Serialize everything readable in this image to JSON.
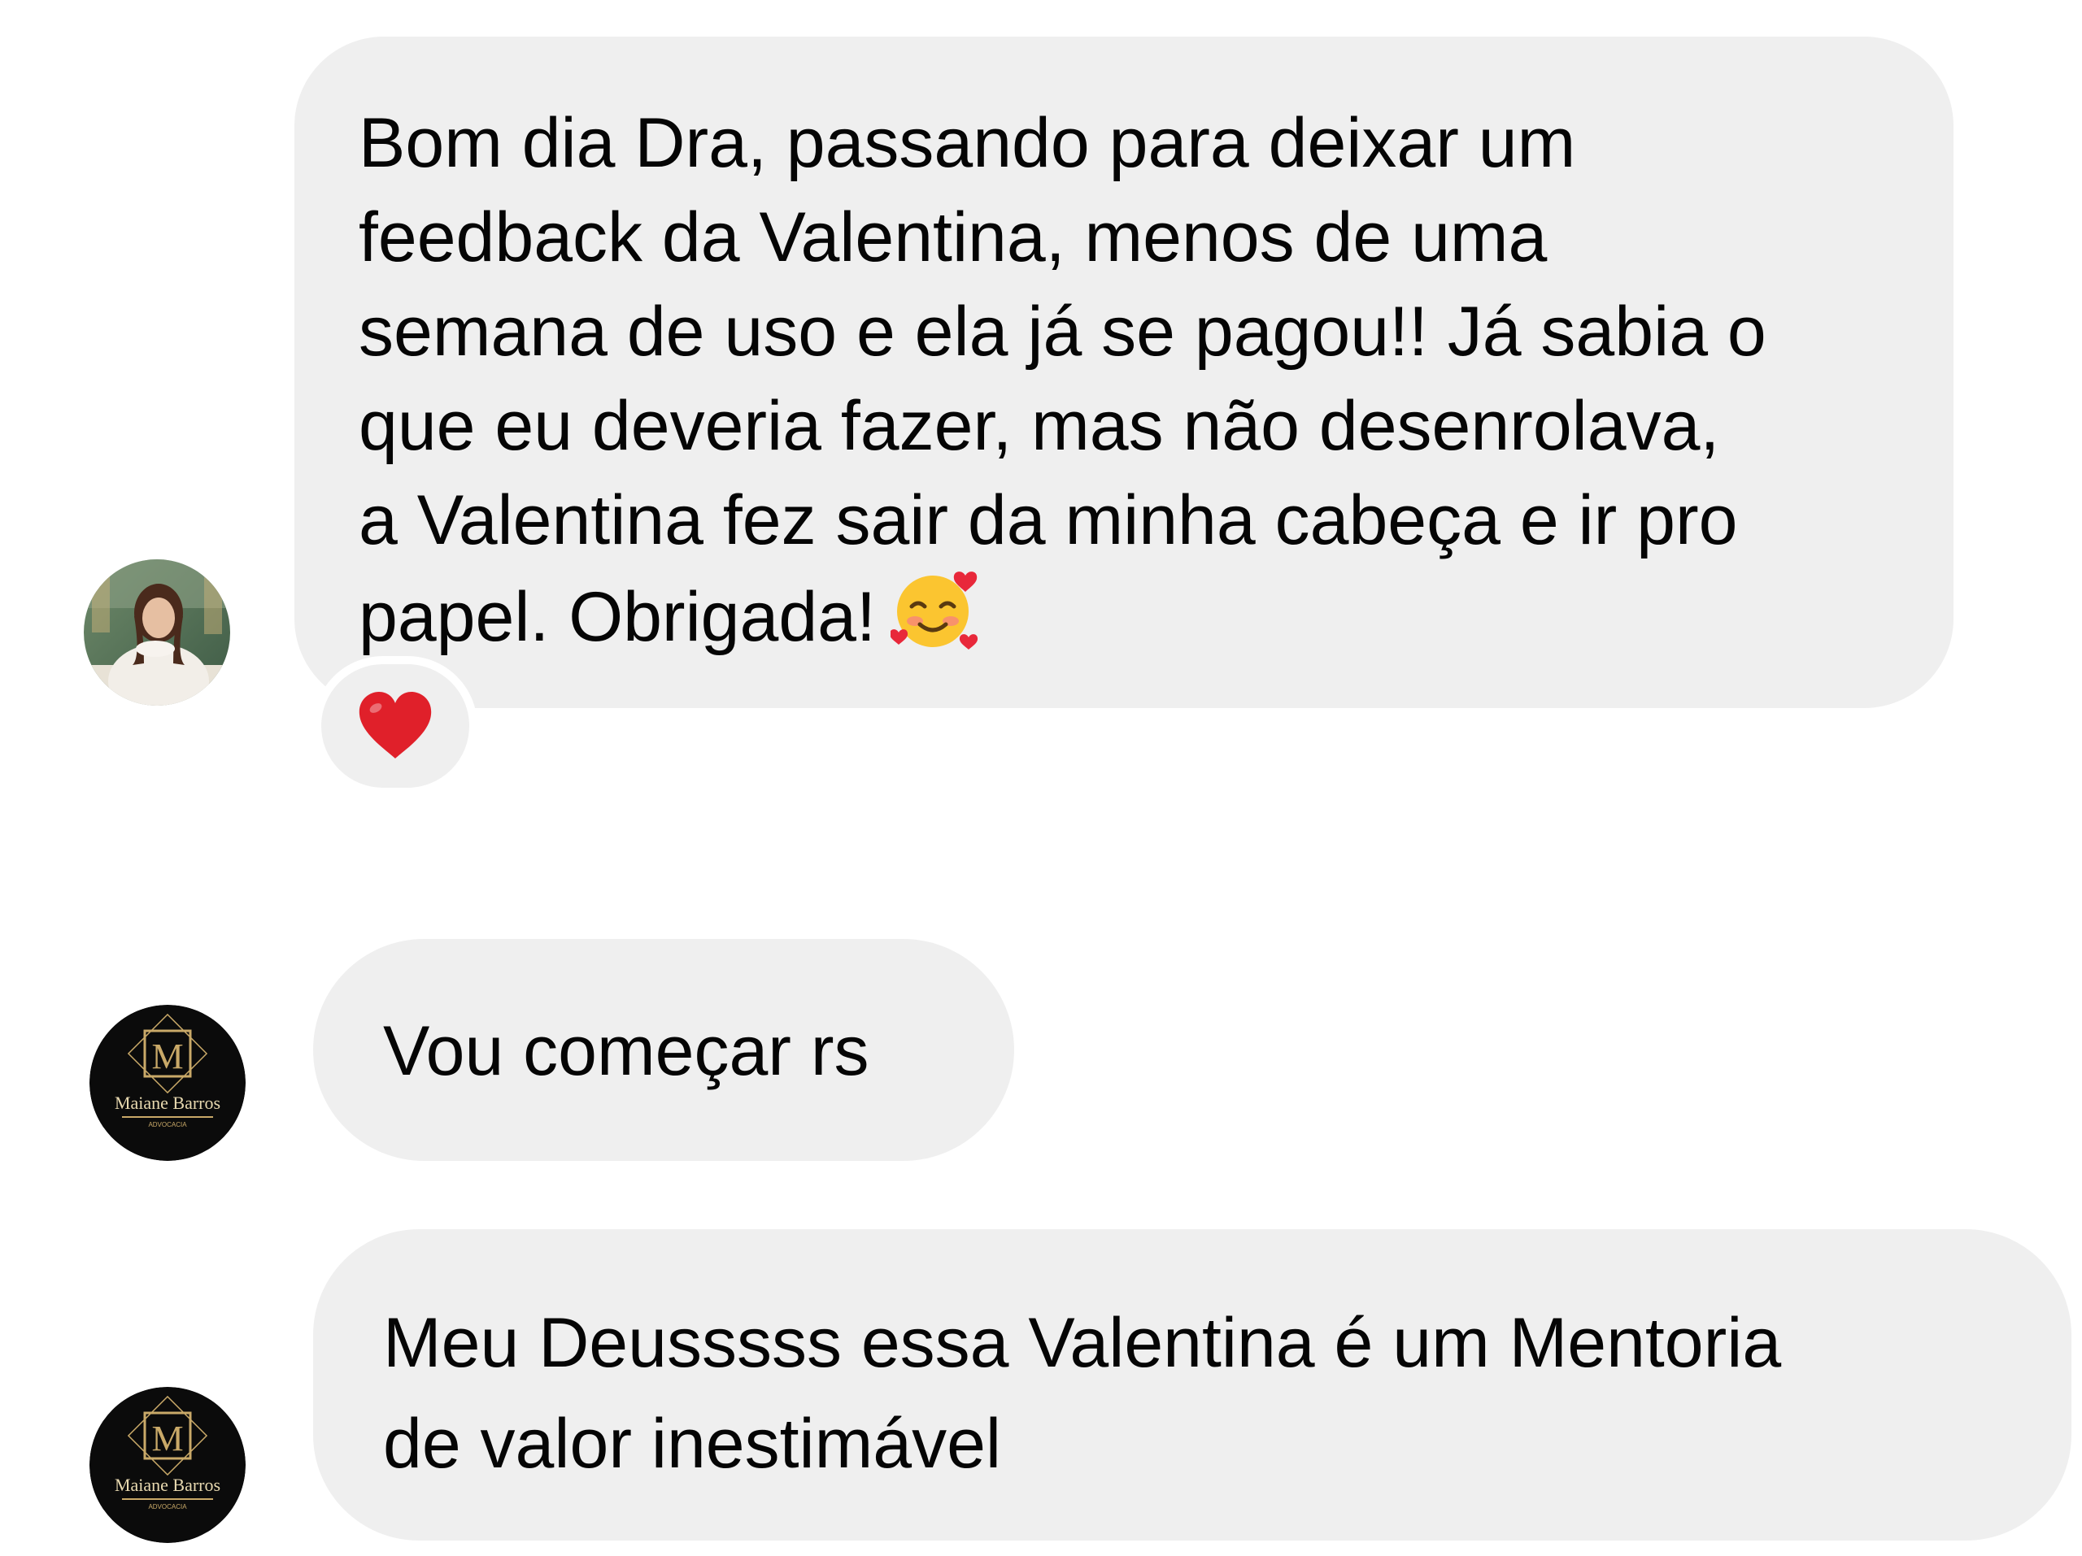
{
  "thread": {
    "messages": [
      {
        "sender_avatar": "woman-photo-avatar",
        "lines": [
          "Bom dia Dra, passando para deixar um",
          "feedback da Valentina, menos de uma",
          "semana de uso e ela já se pagou!! Já sabia o",
          "que eu deveria fazer, mas não desenrolava,",
          "a Valentina fez sair da minha cabeça e ir pro",
          "papel. Obrigada!"
        ],
        "emoji": "smiling-face-with-hearts-icon",
        "reaction": "red-heart-icon"
      },
      {
        "sender_avatar": "maiane-barros-logo-avatar",
        "lines": [
          "Vou começar rs"
        ]
      },
      {
        "sender_avatar": "maiane-barros-logo-avatar",
        "lines": [
          "Meu Deusssss essa Valentina é um Mentoria",
          "de valor inestimável"
        ]
      }
    ],
    "logo": {
      "monogram": "M",
      "name": "Maiane Barros",
      "tagline": "ADVOCACIA"
    }
  },
  "colors": {
    "bubble": "#efefef",
    "text": "#050505",
    "heart": "#e0202a",
    "logo_gold": "#c9a968",
    "logo_bg": "#0b0b0b"
  }
}
